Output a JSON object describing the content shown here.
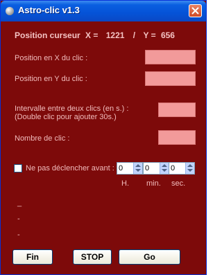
{
  "window": {
    "title": "Astro-clic v1.3",
    "app_icon": "sphere-icon",
    "close_icon": "close-icon"
  },
  "position": {
    "label": "Position curseur",
    "x_label": "X =",
    "x_value": "1221",
    "separator": "/",
    "y_label": "Y =",
    "y_value": "656"
  },
  "fields": {
    "click_x_label": "Position en X du clic :",
    "click_x_value": "",
    "click_y_label": "Position en Y du clic :",
    "click_y_value": "",
    "interval_label_line1": "Intervalle entre deux clics (en s.) :",
    "interval_label_line2": "(Double clic pour ajouter 30s.)",
    "interval_value": "",
    "count_label": "Nombre de clic :",
    "count_value": ""
  },
  "schedule": {
    "checkbox_label": "Ne pas déclencher avant :",
    "checked": false,
    "hours_value": "0",
    "minutes_value": "0",
    "seconds_value": "0",
    "hours_unit": "H.",
    "minutes_unit": "min.",
    "seconds_unit": "sec."
  },
  "status": {
    "line1": "_",
    "line2": "-",
    "line3": "-"
  },
  "buttons": {
    "end_label": "Fin",
    "stop_label": "STOP",
    "go_label": "Go"
  },
  "colors": {
    "background": "#7d0a0a",
    "field_pink": "#f29a9a",
    "label_text": "#f2bcbc"
  }
}
